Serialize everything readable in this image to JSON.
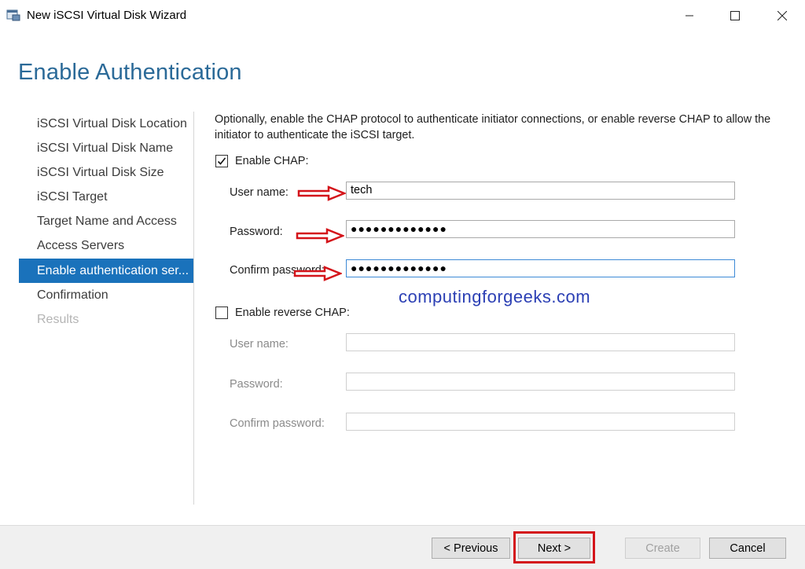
{
  "window": {
    "title": "New iSCSI Virtual Disk Wizard",
    "minimize_icon": "minimize-icon",
    "maximize_icon": "maximize-icon",
    "close_icon": "close-icon"
  },
  "header": {
    "title": "Enable Authentication"
  },
  "steps": [
    {
      "label": "iSCSI Virtual Disk Location",
      "state": "normal"
    },
    {
      "label": "iSCSI Virtual Disk Name",
      "state": "normal"
    },
    {
      "label": "iSCSI Virtual Disk Size",
      "state": "normal"
    },
    {
      "label": "iSCSI Target",
      "state": "normal"
    },
    {
      "label": "Target Name and Access",
      "state": "normal"
    },
    {
      "label": "Access Servers",
      "state": "normal"
    },
    {
      "label": "Enable authentication ser...",
      "state": "active"
    },
    {
      "label": "Confirmation",
      "state": "normal"
    },
    {
      "label": "Results",
      "state": "disabled"
    }
  ],
  "content": {
    "description": "Optionally, enable the CHAP protocol to authenticate initiator connections, or enable reverse CHAP to allow the initiator to authenticate the iSCSI target.",
    "chap": {
      "label": "Enable CHAP:",
      "checked": true,
      "username_label": "User name:",
      "username_value": "tech",
      "password_label": "Password:",
      "password_value": "●●●●●●●●●●●●●",
      "confirm_label": "Confirm password:",
      "confirm_value": "●●●●●●●●●●●●●"
    },
    "reverse_chap": {
      "label": "Enable reverse CHAP:",
      "checked": false,
      "username_label": "User name:",
      "username_value": "",
      "password_label": "Password:",
      "password_value": "",
      "confirm_label": "Confirm password:",
      "confirm_value": ""
    },
    "watermark": "computingforgeeks.com"
  },
  "footer": {
    "previous_label": "< Previous",
    "next_label": "Next >",
    "create_label": "Create",
    "cancel_label": "Cancel"
  },
  "colors": {
    "title_blue": "#2b6a98",
    "active_step": "#1a72bb",
    "annotation_red": "#d4141a",
    "watermark": "#2b3fb4"
  }
}
